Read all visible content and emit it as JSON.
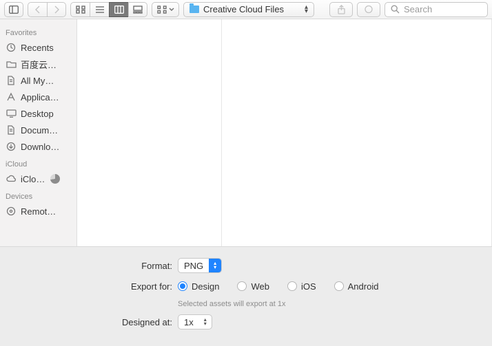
{
  "toolbar": {
    "path_label": "Creative Cloud Files",
    "search_placeholder": "Search"
  },
  "sidebar": {
    "sections": [
      {
        "title": "Favorites",
        "items": [
          {
            "icon": "clock",
            "label": "Recents"
          },
          {
            "icon": "folder",
            "label": "百度云…"
          },
          {
            "icon": "doc",
            "label": "All My…"
          },
          {
            "icon": "app",
            "label": "Applica…"
          },
          {
            "icon": "desktop",
            "label": "Desktop"
          },
          {
            "icon": "doc",
            "label": "Docum…"
          },
          {
            "icon": "download",
            "label": "Downlo…"
          }
        ]
      },
      {
        "title": "iCloud",
        "items": [
          {
            "icon": "cloud",
            "label": "iClo…",
            "badge": "pie"
          }
        ]
      },
      {
        "title": "Devices",
        "items": [
          {
            "icon": "disc",
            "label": "Remot…"
          }
        ]
      }
    ]
  },
  "export": {
    "format_label": "Format:",
    "format_value": "PNG",
    "exportfor_label": "Export for:",
    "options": [
      {
        "label": "Design",
        "checked": true
      },
      {
        "label": "Web",
        "checked": false
      },
      {
        "label": "iOS",
        "checked": false
      },
      {
        "label": "Android",
        "checked": false
      }
    ],
    "hint": "Selected assets will export at 1x",
    "designed_label": "Designed at:",
    "designed_value": "1x"
  }
}
